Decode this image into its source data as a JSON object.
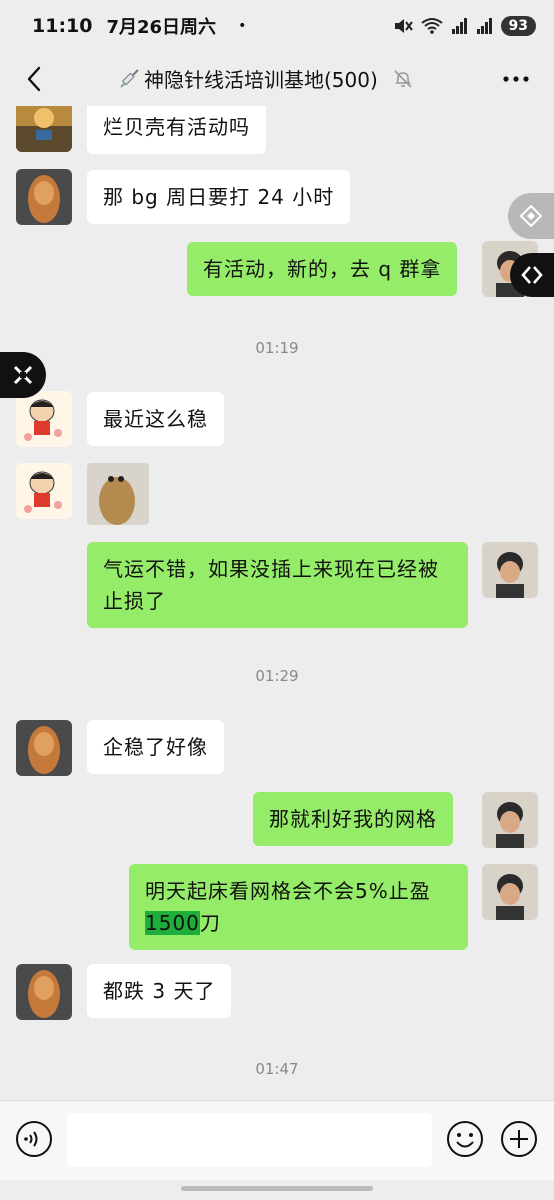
{
  "status": {
    "time": "11:10",
    "date": "7月26日周六",
    "dot": "•",
    "battery": "93"
  },
  "header": {
    "title": "神隐针线活培训基地(500)",
    "title_icon": "syringe-icon",
    "mute_icon": "muted-bell-icon"
  },
  "messages": {
    "m1": "烂贝壳有活动吗",
    "m2": "那 bg 周日要打 24 小时",
    "m3": "有活动，新的，去 q 群拿",
    "t1": "01:19",
    "m4": "最近这么稳",
    "m5_image": "sticker-image",
    "m6": "气运不错，如果没插上来现在已经被止损了",
    "t2": "01:29",
    "m7": "企稳了好像",
    "m8": "那就利好我的网格",
    "m9_pre": "明天起床看网格会不会5%止盈",
    "m9_hl": "1500",
    "m9_post": "刀",
    "m10": "都跌 3 天了",
    "t3": "01:47"
  },
  "input": {
    "placeholder": ""
  },
  "colors": {
    "background": "#ededed",
    "bubble_out": "#95ec69",
    "bubble_in": "#ffffff",
    "highlight": "#1fae3c"
  }
}
